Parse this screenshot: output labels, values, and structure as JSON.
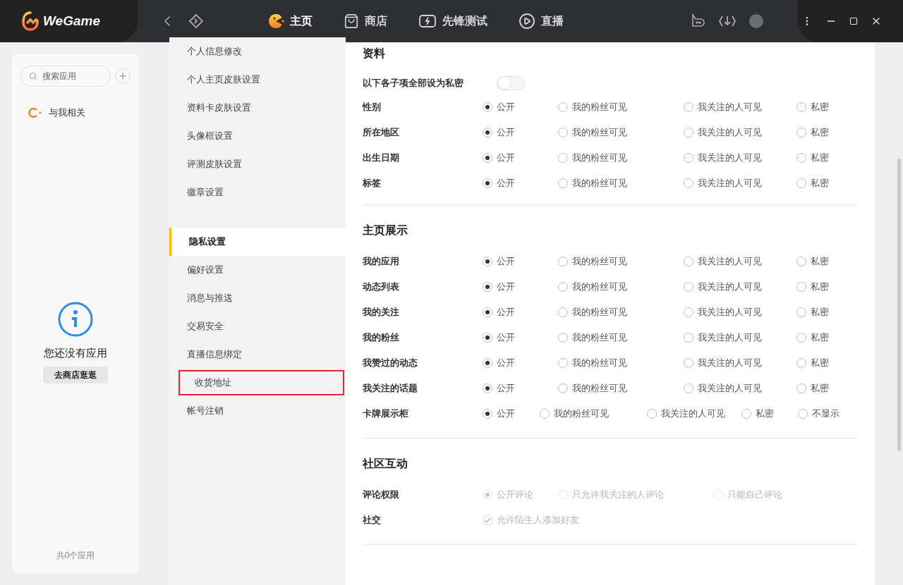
{
  "app": {
    "name": "WeGame"
  },
  "nav": [
    {
      "label": "主页",
      "selected": true,
      "kind": "home"
    },
    {
      "label": "商店",
      "selected": false,
      "kind": "store"
    },
    {
      "label": "先锋测试",
      "selected": false,
      "kind": "test"
    },
    {
      "label": "直播",
      "selected": false,
      "kind": "live"
    }
  ],
  "library": {
    "search_placeholder": "搜索应用",
    "items": [
      {
        "label": "与我相关"
      }
    ],
    "empty_text": "您还没有应用",
    "store_button": "去商店逛逛",
    "count": "共0个应用"
  },
  "menu": [
    {
      "items": [
        {
          "label": "个人信息修改",
          "selected": false,
          "highlighted": false
        },
        {
          "label": "个人主页皮肤设置",
          "selected": false,
          "highlighted": false
        },
        {
          "label": "资料卡皮肤设置",
          "selected": false,
          "highlighted": false
        },
        {
          "label": "头像框设置",
          "selected": false,
          "highlighted": false
        },
        {
          "label": "评测皮肤设置",
          "selected": false,
          "highlighted": false
        },
        {
          "label": "徽章设置",
          "selected": false,
          "highlighted": false
        }
      ]
    },
    {
      "items": [
        {
          "label": "隐私设置",
          "selected": true,
          "highlighted": false
        },
        {
          "label": "偏好设置",
          "selected": false,
          "highlighted": false
        },
        {
          "label": "消息与推送",
          "selected": false,
          "highlighted": false
        },
        {
          "label": "交易安全",
          "selected": false,
          "highlighted": false
        },
        {
          "label": "直播信息绑定",
          "selected": false,
          "highlighted": false
        },
        {
          "label": "收货地址",
          "selected": false,
          "highlighted": true
        },
        {
          "label": "帐号注销",
          "selected": false,
          "highlighted": false
        }
      ]
    }
  ],
  "sections": [
    {
      "title": "资料",
      "toggle": {
        "label": "以下各子项全部设为私密",
        "on": false
      },
      "rows": [
        {
          "label": "性别",
          "kind": "radio",
          "disabled": false,
          "options": [
            {
              "label": "公开",
              "selected": true
            },
            {
              "label": "我的粉丝可见",
              "selected": false
            },
            {
              "label": "我关注的人可见",
              "selected": false
            },
            {
              "label": "私密",
              "selected": false
            }
          ]
        },
        {
          "label": "所在地区",
          "kind": "radio",
          "disabled": false,
          "options": [
            {
              "label": "公开",
              "selected": true
            },
            {
              "label": "我的粉丝可见",
              "selected": false
            },
            {
              "label": "我关注的人可见",
              "selected": false
            },
            {
              "label": "私密",
              "selected": false
            }
          ]
        },
        {
          "label": "出生日期",
          "kind": "radio",
          "disabled": false,
          "options": [
            {
              "label": "公开",
              "selected": true
            },
            {
              "label": "我的粉丝可见",
              "selected": false
            },
            {
              "label": "我关注的人可见",
              "selected": false
            },
            {
              "label": "私密",
              "selected": false
            }
          ]
        },
        {
          "label": "标签",
          "kind": "radio",
          "disabled": false,
          "options": [
            {
              "label": "公开",
              "selected": true
            },
            {
              "label": "我的粉丝可见",
              "selected": false
            },
            {
              "label": "我关注的人可见",
              "selected": false
            },
            {
              "label": "私密",
              "selected": false
            }
          ]
        }
      ]
    },
    {
      "title": "主页展示",
      "rows": [
        {
          "label": "我的应用",
          "kind": "radio",
          "disabled": false,
          "options": [
            {
              "label": "公开",
              "selected": true
            },
            {
              "label": "我的粉丝可见",
              "selected": false
            },
            {
              "label": "我关注的人可见",
              "selected": false
            },
            {
              "label": "私密",
              "selected": false
            }
          ]
        },
        {
          "label": "动态列表",
          "kind": "radio",
          "disabled": false,
          "options": [
            {
              "label": "公开",
              "selected": true
            },
            {
              "label": "我的粉丝可见",
              "selected": false
            },
            {
              "label": "我关注的人可见",
              "selected": false
            },
            {
              "label": "私密",
              "selected": false
            }
          ]
        },
        {
          "label": "我的关注",
          "kind": "radio",
          "disabled": false,
          "options": [
            {
              "label": "公开",
              "selected": true
            },
            {
              "label": "我的粉丝可见",
              "selected": false
            },
            {
              "label": "我关注的人可见",
              "selected": false
            },
            {
              "label": "私密",
              "selected": false
            }
          ]
        },
        {
          "label": "我的粉丝",
          "kind": "radio",
          "disabled": false,
          "options": [
            {
              "label": "公开",
              "selected": true
            },
            {
              "label": "我的粉丝可见",
              "selected": false
            },
            {
              "label": "我关注的人可见",
              "selected": false
            },
            {
              "label": "私密",
              "selected": false
            }
          ]
        },
        {
          "label": "我赞过的动态",
          "kind": "radio",
          "disabled": false,
          "options": [
            {
              "label": "公开",
              "selected": true
            },
            {
              "label": "我的粉丝可见",
              "selected": false
            },
            {
              "label": "我关注的人可见",
              "selected": false
            },
            {
              "label": "私密",
              "selected": false
            }
          ]
        },
        {
          "label": "我关注的话题",
          "kind": "radio",
          "disabled": false,
          "options": [
            {
              "label": "公开",
              "selected": true
            },
            {
              "label": "我的粉丝可见",
              "selected": false
            },
            {
              "label": "我关注的人可见",
              "selected": false
            },
            {
              "label": "私密",
              "selected": false
            }
          ]
        },
        {
          "label": "卡牌展示柜",
          "kind": "radio",
          "disabled": false,
          "options": [
            {
              "label": "公开",
              "selected": true
            },
            {
              "label": "我的粉丝可见",
              "selected": false
            },
            {
              "label": "我关注的人可见",
              "selected": false
            },
            {
              "label": "私密",
              "selected": false
            },
            {
              "label": "不显示",
              "selected": false
            }
          ]
        }
      ]
    },
    {
      "title": "社区互动",
      "rows": [
        {
          "label": "评论权限",
          "kind": "radio",
          "disabled": true,
          "options": [
            {
              "label": "公开评论",
              "selected": true
            },
            {
              "label": "只允许我关注的人评论",
              "selected": false
            },
            {
              "label": "只能自己评论",
              "selected": false
            }
          ]
        },
        {
          "label": "社交",
          "kind": "checkbox",
          "disabled": true,
          "options": [
            {
              "label": "允许陌生人添加好友",
              "checked": true
            }
          ]
        }
      ]
    }
  ]
}
